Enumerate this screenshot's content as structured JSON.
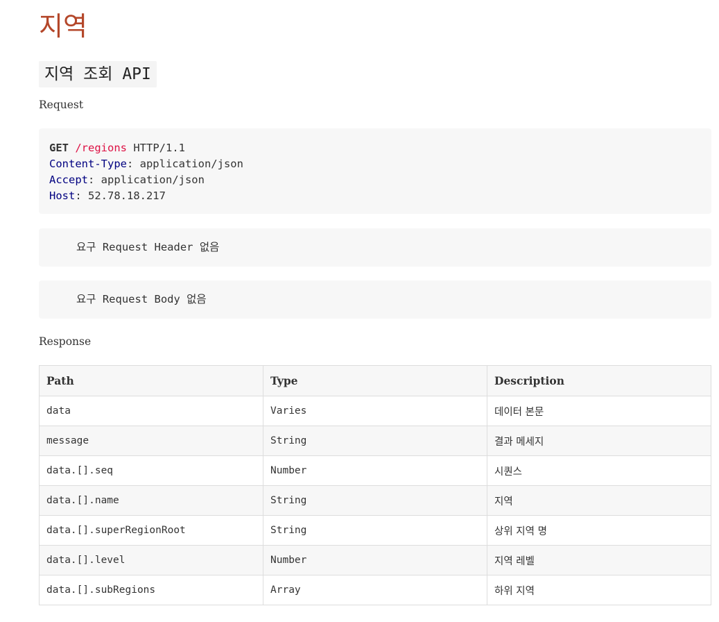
{
  "page_title": "지역",
  "section_title": "지역 조회 API",
  "request": {
    "label": "Request",
    "code": {
      "method": "GET",
      "path": "/regions",
      "protocol": " HTTP/1.1",
      "headers": [
        {
          "key": "Content-Type",
          "value": ": application/json"
        },
        {
          "key": "Accept",
          "value": ": application/json"
        },
        {
          "key": "Host",
          "value": ": 52.78.18.217"
        }
      ]
    },
    "header_note": "요구 Request Header 없음",
    "body_note": "요구 Request Body 없음"
  },
  "response": {
    "label": "Response",
    "columns": [
      "Path",
      "Type",
      "Description"
    ],
    "rows": [
      {
        "path": "data",
        "type": "Varies",
        "description": "데이터 본문"
      },
      {
        "path": "message",
        "type": "String",
        "description": "결과 메세지"
      },
      {
        "path": "data.[].seq",
        "type": "Number",
        "description": "시퀀스"
      },
      {
        "path": "data.[].name",
        "type": "String",
        "description": "지역"
      },
      {
        "path": "data.[].superRegionRoot",
        "type": "String",
        "description": "상위 지역 명"
      },
      {
        "path": "data.[].level",
        "type": "Number",
        "description": "지역 레벨"
      },
      {
        "path": "data.[].subRegions",
        "type": "Array",
        "description": "하위 지역"
      }
    ]
  },
  "colors": {
    "title": "#b4472a",
    "code_path": "#dd1144",
    "code_key": "#000080",
    "block_bg": "#f7f7f7"
  }
}
